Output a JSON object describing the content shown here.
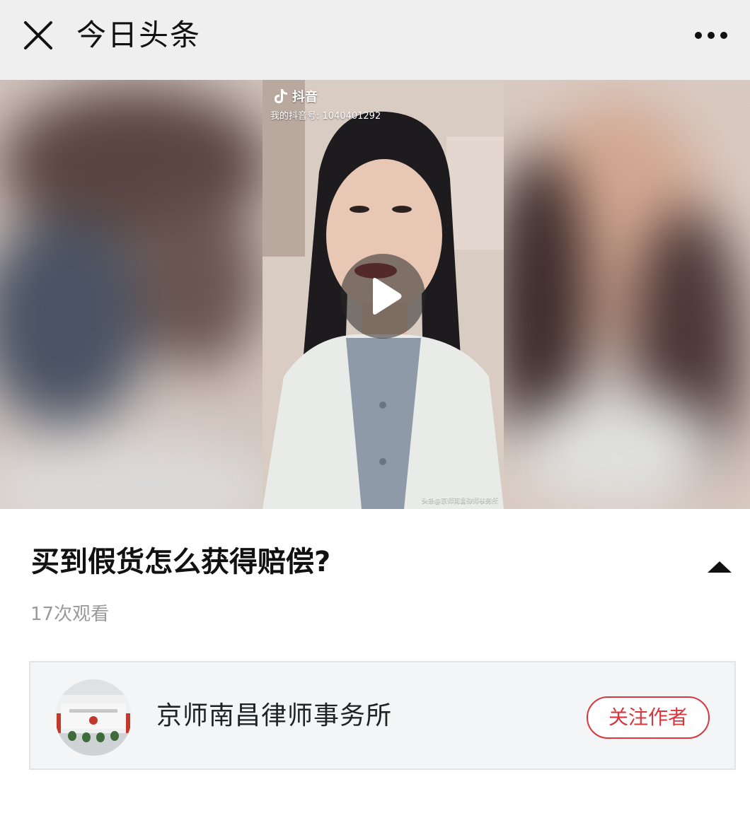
{
  "header": {
    "title": "今日头条",
    "close_icon": "close-icon",
    "more_icon": "more-icon"
  },
  "video": {
    "platform_name": "抖音",
    "platform_id_text": "我的抖音号: 1040401292",
    "watermark": "头条@京师南昌律师事务所",
    "play_icon": "play-icon"
  },
  "article": {
    "title": "买到假货怎么获得赔偿?",
    "view_count": "17次观看",
    "collapse_icon": "triangle-up-icon"
  },
  "author": {
    "name": "京师南昌律师事务所",
    "follow_label": "关注作者",
    "accent_color": "#d9363e"
  }
}
